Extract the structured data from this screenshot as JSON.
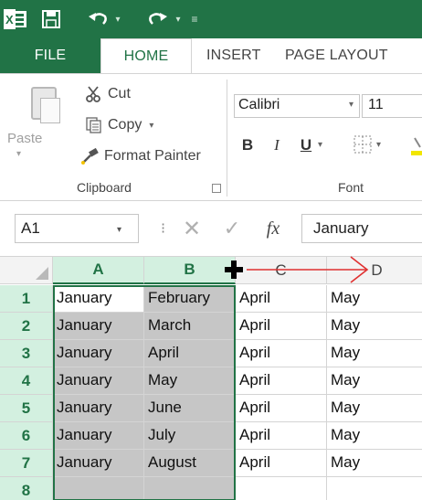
{
  "ribbon_tabs": {
    "file": "FILE",
    "home": "HOME",
    "insert": "INSERT",
    "page_layout": "PAGE LAYOUT"
  },
  "clipboard": {
    "paste": "Paste",
    "cut": "Cut",
    "copy": "Copy",
    "format_painter": "Format Painter",
    "group_label": "Clipboard"
  },
  "font": {
    "name": "Calibri",
    "size": "11",
    "bold": "B",
    "italic": "I",
    "underline": "U",
    "group_label": "Font"
  },
  "formula_bar": {
    "name_box": "A1",
    "fx": "fx",
    "content": "January"
  },
  "grid": {
    "columns": [
      "A",
      "B",
      "C",
      "D"
    ],
    "rows": [
      {
        "num": "1",
        "cells": [
          "January",
          "February",
          "April",
          "May"
        ]
      },
      {
        "num": "2",
        "cells": [
          "January",
          "March",
          "April",
          "May"
        ]
      },
      {
        "num": "3",
        "cells": [
          "January",
          "April",
          "April",
          "May"
        ]
      },
      {
        "num": "4",
        "cells": [
          "January",
          "May",
          "April",
          "May"
        ]
      },
      {
        "num": "5",
        "cells": [
          "January",
          "June",
          "April",
          "May"
        ]
      },
      {
        "num": "6",
        "cells": [
          "January",
          "July",
          "April",
          "May"
        ]
      },
      {
        "num": "7",
        "cells": [
          "January",
          "August",
          "April",
          "May"
        ]
      },
      {
        "num": "8",
        "cells": [
          "",
          "",
          "",
          ""
        ]
      }
    ]
  },
  "colors": {
    "excel_green": "#217346",
    "selection_fill": "#c6c6c6",
    "header_highlight": "#d3f0e0",
    "annotation_arrow": "#e03030"
  }
}
